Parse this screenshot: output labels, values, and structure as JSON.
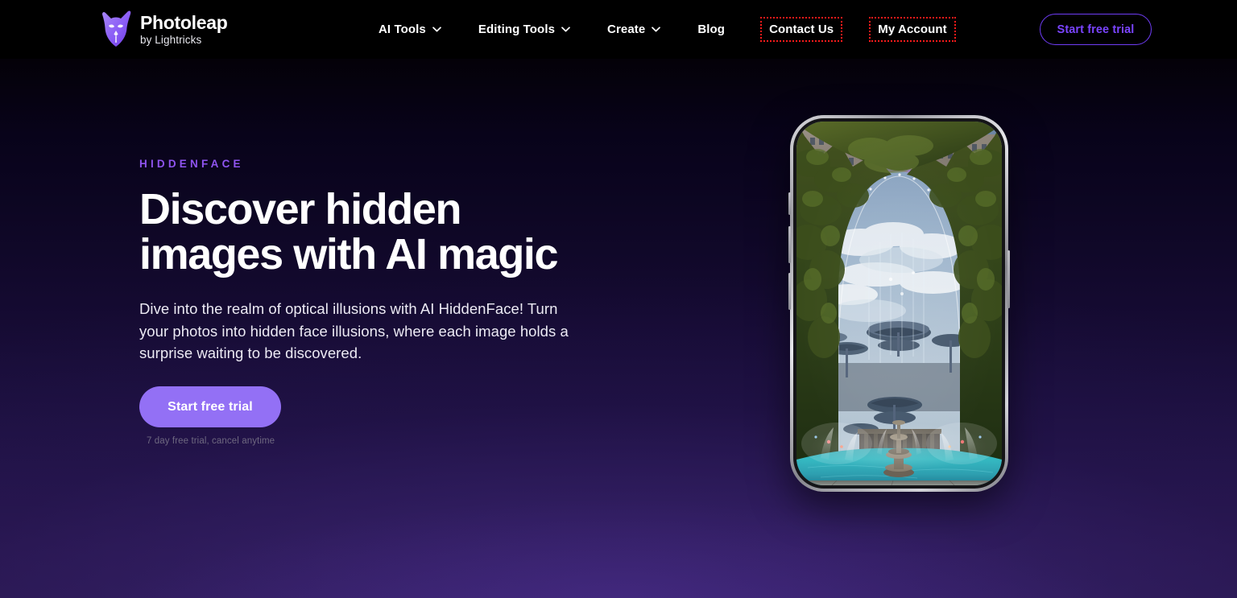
{
  "site": {
    "logo": {
      "name": "Photoleap",
      "byline": "by Lightricks",
      "icon": "fox-head-logo-icon",
      "color": "#8a5cf6"
    }
  },
  "header": {
    "nav_items": [
      {
        "label": "AI Tools",
        "has_dropdown": true,
        "highlighted": false,
        "icon": "chevron-down-icon"
      },
      {
        "label": "Editing Tools",
        "has_dropdown": true,
        "highlighted": false,
        "icon": "chevron-down-icon"
      },
      {
        "label": "Create",
        "has_dropdown": true,
        "highlighted": false,
        "icon": "chevron-down-icon"
      },
      {
        "label": "Blog",
        "has_dropdown": false,
        "highlighted": false,
        "icon": ""
      },
      {
        "label": "Contact Us",
        "has_dropdown": false,
        "highlighted": true,
        "icon": ""
      },
      {
        "label": "My Account",
        "has_dropdown": false,
        "highlighted": true,
        "icon": ""
      }
    ],
    "cta_label": "Start free trial",
    "highlight_color": "#f41a1a",
    "cta_border_color": "#6f3cf5",
    "cta_text_color": "#7a44ff",
    "background_color": "#000000"
  },
  "hero": {
    "eyebrow": "HiddenFace",
    "headline": "Discover hidden images with AI magic",
    "subcopy": "Dive into the realm of optical illusions with AI HiddenFace! Turn your photos into hidden face illusions, where each image holds a surprise waiting to be discovered.",
    "cta_label": "Start free trial",
    "fineprint": "7 day free trial, cancel anytime",
    "eyebrow_color": "#8f54f0",
    "cta_background": "#9370f5",
    "background_gradient_top": "#040108",
    "background_gradient_bottom": "#2c1a55"
  },
  "phone_mockup": {
    "alt": "Phone showing an AI hidden-face illusion of a park fountain framed by a tree archway",
    "frame_color": "#c6c6cc"
  }
}
